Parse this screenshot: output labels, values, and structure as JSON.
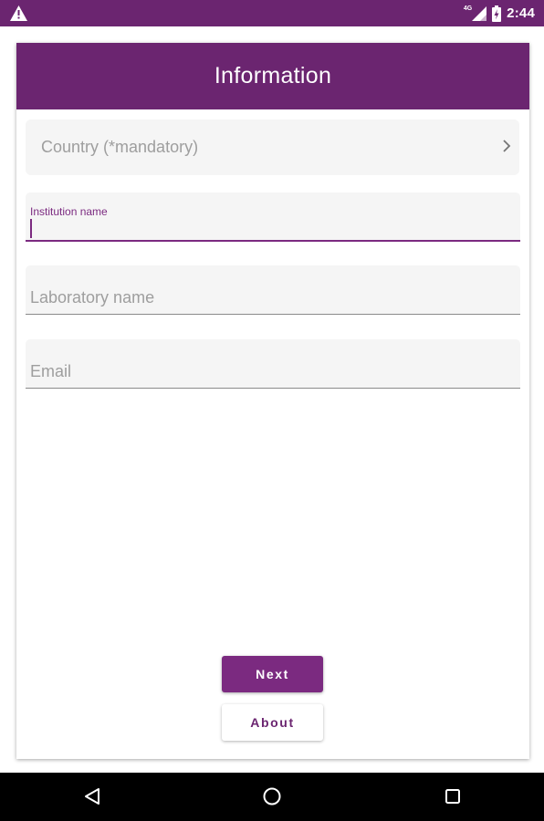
{
  "status_bar": {
    "network_label": "4G",
    "time": "2:44",
    "icons": [
      "warning-icon",
      "signal-icon",
      "battery-icon"
    ]
  },
  "card": {
    "title": "Information"
  },
  "form": {
    "country": {
      "label": "Country (*mandatory)",
      "icon": "chevron-right-icon"
    },
    "institution": {
      "label": "Institution name",
      "value": ""
    },
    "laboratory": {
      "placeholder": "Laboratory name",
      "value": ""
    },
    "email": {
      "placeholder": "Email",
      "value": ""
    }
  },
  "actions": {
    "next_label": "Next",
    "about_label": "About"
  },
  "nav_bar": {
    "icons": [
      "back-icon",
      "home-icon",
      "recents-icon"
    ]
  },
  "colors": {
    "primary": "#6b2570",
    "accent": "#7b2a80",
    "field_background": "#f5f5f5",
    "placeholder_text": "#9e9e9e"
  }
}
